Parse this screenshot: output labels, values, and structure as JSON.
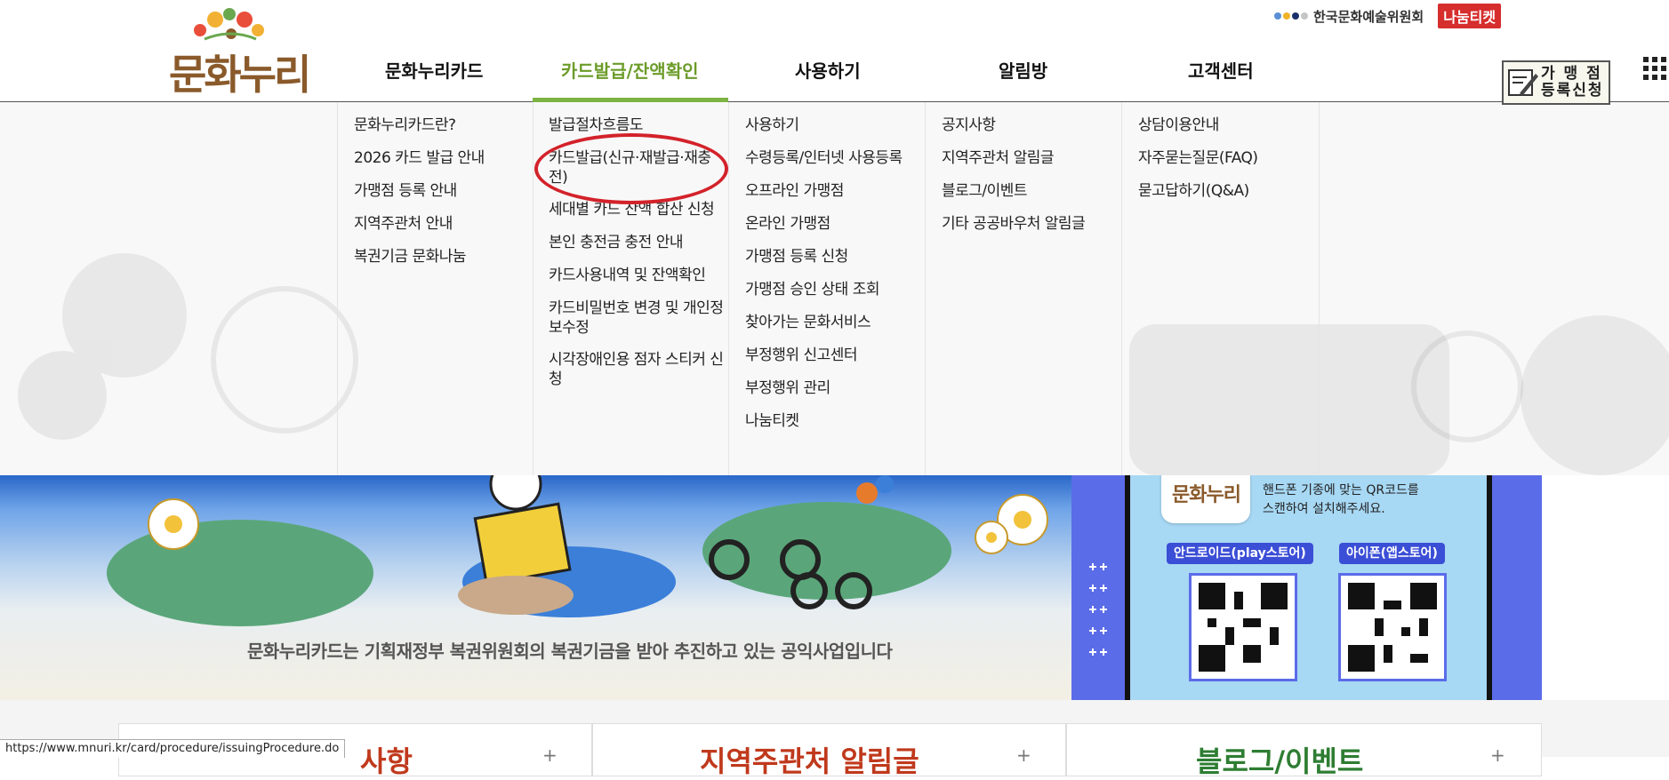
{
  "logo": {
    "text": "문화누리"
  },
  "top_org": {
    "name": "한국문화예술위원회",
    "nanum": "나눔티켓"
  },
  "register_button": {
    "line1": "가 맹 점",
    "line2": "등록신청"
  },
  "gnb": [
    {
      "label": "문화누리카드"
    },
    {
      "label": "카드발급/잔액확인"
    },
    {
      "label": "사용하기"
    },
    {
      "label": "알림방"
    },
    {
      "label": "고객센터"
    }
  ],
  "mega": {
    "col1": [
      "문화누리카드란?",
      "2026 카드 발급 안내",
      "가맹점 등록 안내",
      "지역주관처 안내",
      "복권기금 문화나눔"
    ],
    "col2": [
      "발급절차흐름도",
      "카드발급(신규·재발급·재충전)",
      "세대별 카드 잔액 합산 신청",
      "본인 충전금 충전 안내",
      "카드사용내역 및 잔액확인",
      "카드비밀번호 변경 및 개인정보수정",
      "시각장애인용 점자 스티커 신청"
    ],
    "col3": [
      "사용하기",
      "수령등록/인터넷 사용등록",
      "오프라인 가맹점",
      "온라인 가맹점",
      "가맹점 등록 신청",
      "가맹점 승인 상태 조회",
      "찾아가는 문화서비스",
      "부정행위 신고센터",
      "부정행위 관리",
      "나눔티켓"
    ],
    "col4": [
      "공지사항",
      "지역주관처 알림글",
      "블로그/이벤트",
      "기타 공공바우처 알림글"
    ],
    "col5": [
      "상담이용안내",
      "자주묻는질문(FAQ)",
      "묻고답하기(Q&A)"
    ]
  },
  "banner": {
    "caption": "문화누리카드는 기획재정부 복권위원회의 복권기금을 받아 추진하고 있는 공익사업입니다"
  },
  "app": {
    "icon_text": "문화누리",
    "desc_line1": "핸드폰 기종에 맞는 QR코드를",
    "desc_line2": "스캔하여 설치해주세요.",
    "android": "안드로이드(play스토어)",
    "ios": "아이폰(앱스토어)"
  },
  "cards": [
    {
      "title": "사항"
    },
    {
      "title": "지역주관처 알림글"
    },
    {
      "title": "블로그/이벤트"
    }
  ],
  "status_url": "https://www.mnuri.kr/card/procedure/issuingProcedure.do",
  "colors": {
    "accent": "#7cb342",
    "highlight_circle": "#d3222a",
    "brand_brown": "#8a5a2b",
    "app_panel": "#5b6ce8"
  }
}
